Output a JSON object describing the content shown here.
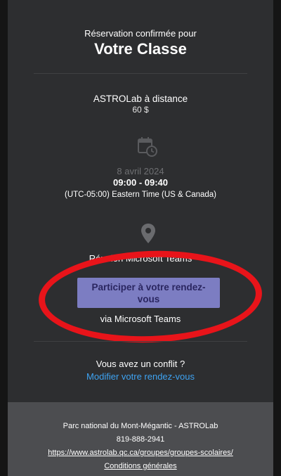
{
  "header": {
    "intro": "Réservation confirmée pour",
    "title": "Votre Classe"
  },
  "service": {
    "name": "ASTROLab à distance",
    "price": "60 $"
  },
  "schedule": {
    "icon": "calendar-clock-icon",
    "date": "8 avril 2024",
    "time": "09:00 - 09:40",
    "timezone": "(UTC-05:00) Eastern Time (US & Canada)"
  },
  "location": {
    "icon": "map-pin-icon",
    "text": "Réunion Microsoft Teams"
  },
  "meeting": {
    "join_label": "Participer à votre rendez-vous",
    "via": "via Microsoft Teams"
  },
  "conflict": {
    "question": "Vous avez un conflit ?",
    "modify_link": "Modifier votre rendez-vous"
  },
  "footer": {
    "org": "Parc national du Mont-Mégantic - ASTROLab",
    "phone": "819-888-2941",
    "url": "https://www.astrolab.qc.ca/groupes/groupes-scolaires/",
    "terms": "Conditions générales"
  },
  "colors": {
    "card_bg": "#2d2e30",
    "button_bg": "#7c7dc2",
    "link": "#3ea3f2",
    "annotation_red": "#e8141a",
    "footer_bg": "#4c4d50"
  }
}
